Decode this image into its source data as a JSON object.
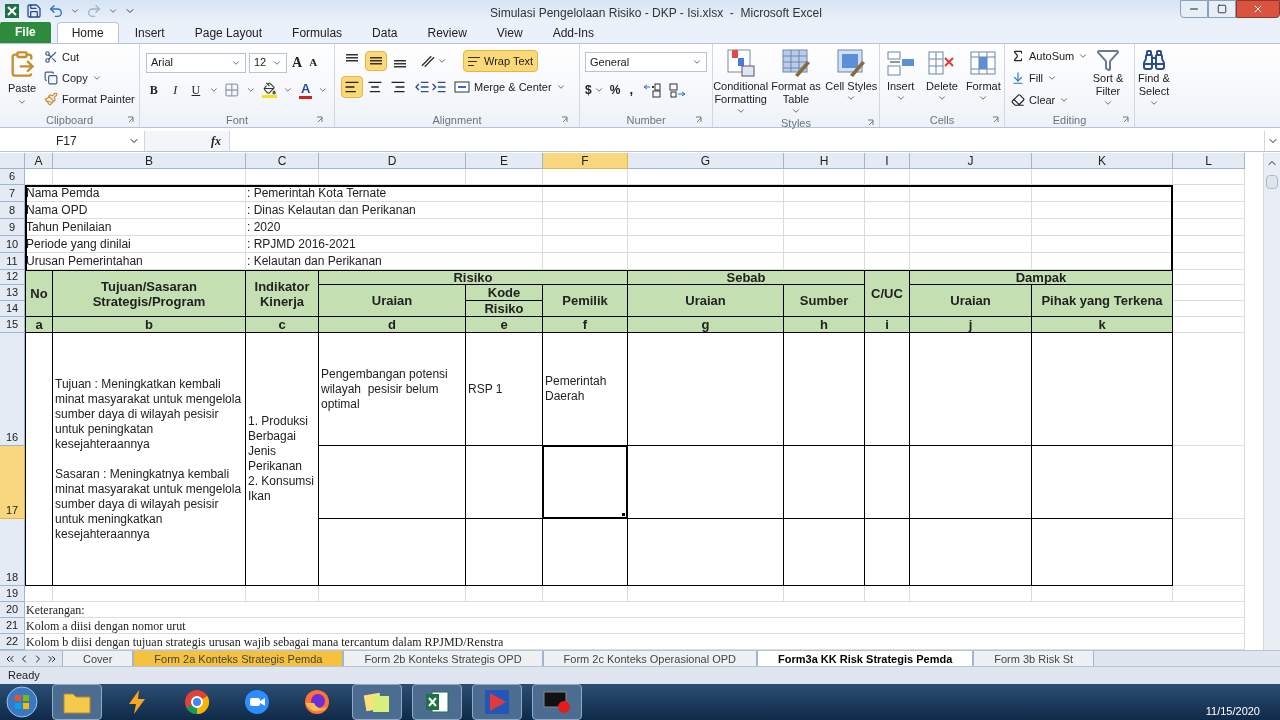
{
  "window": {
    "title": "Simulasi Pengelolaan Risiko - DKP - Isi.xlsx  -  Microsoft Excel"
  },
  "ribbon_tabs": [
    {
      "label": "File",
      "kind": "file",
      "selected": false
    },
    {
      "label": "Home",
      "kind": "tab",
      "selected": true
    },
    {
      "label": "Insert",
      "kind": "tab",
      "selected": false
    },
    {
      "label": "Page Layout",
      "kind": "tab",
      "selected": false
    },
    {
      "label": "Formulas",
      "kind": "tab",
      "selected": false
    },
    {
      "label": "Data",
      "kind": "tab",
      "selected": false
    },
    {
      "label": "Review",
      "kind": "tab",
      "selected": false
    },
    {
      "label": "View",
      "kind": "tab",
      "selected": false
    },
    {
      "label": "Add-Ins",
      "kind": "tab",
      "selected": false
    }
  ],
  "ribbon": {
    "clipboard": {
      "label": "Clipboard",
      "paste": "Paste",
      "cut": "Cut",
      "copy": "Copy",
      "format_painter": "Format Painter"
    },
    "font": {
      "label": "Font",
      "name": "Arial",
      "size": "12",
      "grow": "A",
      "shrink": "A",
      "bold": "B",
      "italic": "I",
      "underline": "U",
      "font_color": "A"
    },
    "alignment": {
      "label": "Alignment",
      "vertical": [
        {
          "selected": false
        },
        {
          "selected": true
        },
        {
          "selected": false
        }
      ],
      "horizontal": [
        {
          "selected": true
        },
        {
          "selected": false
        },
        {
          "selected": false
        }
      ],
      "wrap_text": {
        "label": "Wrap Text",
        "on": true
      },
      "merge": "Merge & Center"
    },
    "number": {
      "label": "Number",
      "format": "General",
      "currency": "$",
      "percent": "%",
      "comma": ","
    },
    "styles": {
      "label": "Styles",
      "buttons": [
        {
          "label": "Conditional Formatting",
          "kind": "conditional"
        },
        {
          "label": "Format as Table",
          "kind": "table"
        },
        {
          "label": "Cell Styles",
          "kind": "cellstyles"
        }
      ]
    },
    "cells": {
      "label": "Cells",
      "buttons": [
        {
          "label": "Insert",
          "kind": "insert"
        },
        {
          "label": "Delete",
          "kind": "delete"
        },
        {
          "label": "Format",
          "kind": "format"
        }
      ]
    },
    "editing": {
      "label": "Editing",
      "autosum": "AutoSum",
      "fill": "Fill",
      "clear": "Clear",
      "sort": "Sort & Filter",
      "find": "Find & Select"
    }
  },
  "formula_bar": {
    "name_box": "F17",
    "function_label": "fx"
  },
  "columns": [
    {
      "label": "A",
      "selected": false
    },
    {
      "label": "B",
      "selected": false
    },
    {
      "label": "C",
      "selected": false
    },
    {
      "label": "D",
      "selected": false
    },
    {
      "label": "E",
      "selected": false
    },
    {
      "label": "F",
      "selected": true
    },
    {
      "label": "G",
      "selected": false
    },
    {
      "label": "H",
      "selected": false
    },
    {
      "label": "I",
      "selected": false
    },
    {
      "label": "J",
      "selected": false
    },
    {
      "label": "K",
      "selected": false
    },
    {
      "label": "L",
      "selected": false
    }
  ],
  "rows": [
    {
      "label": "6",
      "selected": false
    },
    {
      "label": "7",
      "selected": false
    },
    {
      "label": "8",
      "selected": false
    },
    {
      "label": "9",
      "selected": false
    },
    {
      "label": "10",
      "selected": false
    },
    {
      "label": "11",
      "selected": false
    },
    {
      "label": "12",
      "selected": false
    },
    {
      "label": "13",
      "selected": false
    },
    {
      "label": "14",
      "selected": false
    },
    {
      "label": "15",
      "selected": false
    },
    {
      "label": "16",
      "selected": false
    },
    {
      "label": "17",
      "selected": true
    },
    {
      "label": "18",
      "selected": false
    },
    {
      "label": "19",
      "selected": false
    },
    {
      "label": "20",
      "selected": false
    },
    {
      "label": "21",
      "selected": false
    },
    {
      "label": "22",
      "selected": false
    }
  ],
  "info": [
    {
      "label": "Nama Pemda",
      "value": ": Pemerintah Kota Ternate"
    },
    {
      "label": "Nama OPD",
      "value": ": Dinas Kelautan dan Perikanan"
    },
    {
      "label": "Tahun Penilaian",
      "value": ": 2020"
    },
    {
      "label": "Periode yang dinilai",
      "value": ": RPJMD 2016-2021"
    },
    {
      "label": "Urusan Pemerintahan",
      "value": ": Kelautan dan Perikanan"
    }
  ],
  "table_header": {
    "no": "No",
    "tujuan": "Tujuan/Sasaran Strategis/Program",
    "indikator": "Indikator Kinerja",
    "risiko": {
      "title": "Risiko",
      "uraian": "Uraian",
      "kode": "Kode",
      "kode_2": "Risiko",
      "pemilik": "Pemilik"
    },
    "sebab": {
      "title": "Sebab",
      "uraian": "Uraian",
      "sumber": "Sumber"
    },
    "cuc": "C/UC",
    "dampak": {
      "title": "Dampak",
      "uraian": "Uraian",
      "pihak": "Pihak yang Terkena"
    },
    "letters": [
      "a",
      "b",
      "c",
      "d",
      "e",
      "f",
      "g",
      "h",
      "i",
      "j",
      "k"
    ]
  },
  "body": {
    "tujuan": [
      "Tujuan : Meningkatkan kembali minat masyarakat untuk mengelola sumber daya di wilayah pesisir untuk peningkatan kesejahteraannya",
      "Sasaran : Meningkatnya kembali minat masyarakat untuk mengelola sumber daya di wilayah pesisir untuk meningkatkan kesejahteraannya"
    ],
    "indikator": [
      "1. Produksi Berbagai Jenis Perikanan",
      "2. Konsumsi Ikan"
    ],
    "risks": [
      {
        "uraian": "Pengembangan potensi wilayah  pesisir belum optimal",
        "kode": "RSP 1",
        "pemilik": "Pemerintah Daerah"
      }
    ]
  },
  "notes": [
    "Keterangan:",
    "Kolom a diisi dengan nomor urut",
    "Kolom b diisi dengan tujuan strategis urusan wajib sebagai mana tercantum dalam RPJMD/Renstra"
  ],
  "sheet_tabs": [
    {
      "label": "Cover",
      "selected": false,
      "color": "#eef0f3"
    },
    {
      "label": "Form 2a Konteks Strategis Pemda",
      "selected": false,
      "color": "#f6c23e"
    },
    {
      "label": "Form 2b Konteks Strategis OPD",
      "selected": false,
      "color": "#eef0f3"
    },
    {
      "label": "Form 2c Konteks Operasional OPD",
      "selected": false,
      "color": "#eef0f3"
    },
    {
      "label": "Form3a KK Risk Strategis Pemda",
      "selected": true,
      "color": "#ffffff"
    },
    {
      "label": "Form 3b Risk St",
      "selected": false,
      "color": "#eef0f3"
    }
  ],
  "status_bar": {
    "text": "Ready"
  },
  "taskbar": {
    "items": [
      {
        "kind": "folder",
        "running": true
      },
      {
        "kind": "bolt",
        "running": false
      },
      {
        "kind": "chrome",
        "running": false
      },
      {
        "kind": "camera",
        "running": false
      },
      {
        "kind": "firefox",
        "running": false
      },
      {
        "kind": "notes",
        "running": true
      },
      {
        "kind": "excel",
        "running": true
      },
      {
        "kind": "slides",
        "running": true
      },
      {
        "kind": "recorder",
        "running": true
      }
    ],
    "date": "11/15/2020"
  }
}
